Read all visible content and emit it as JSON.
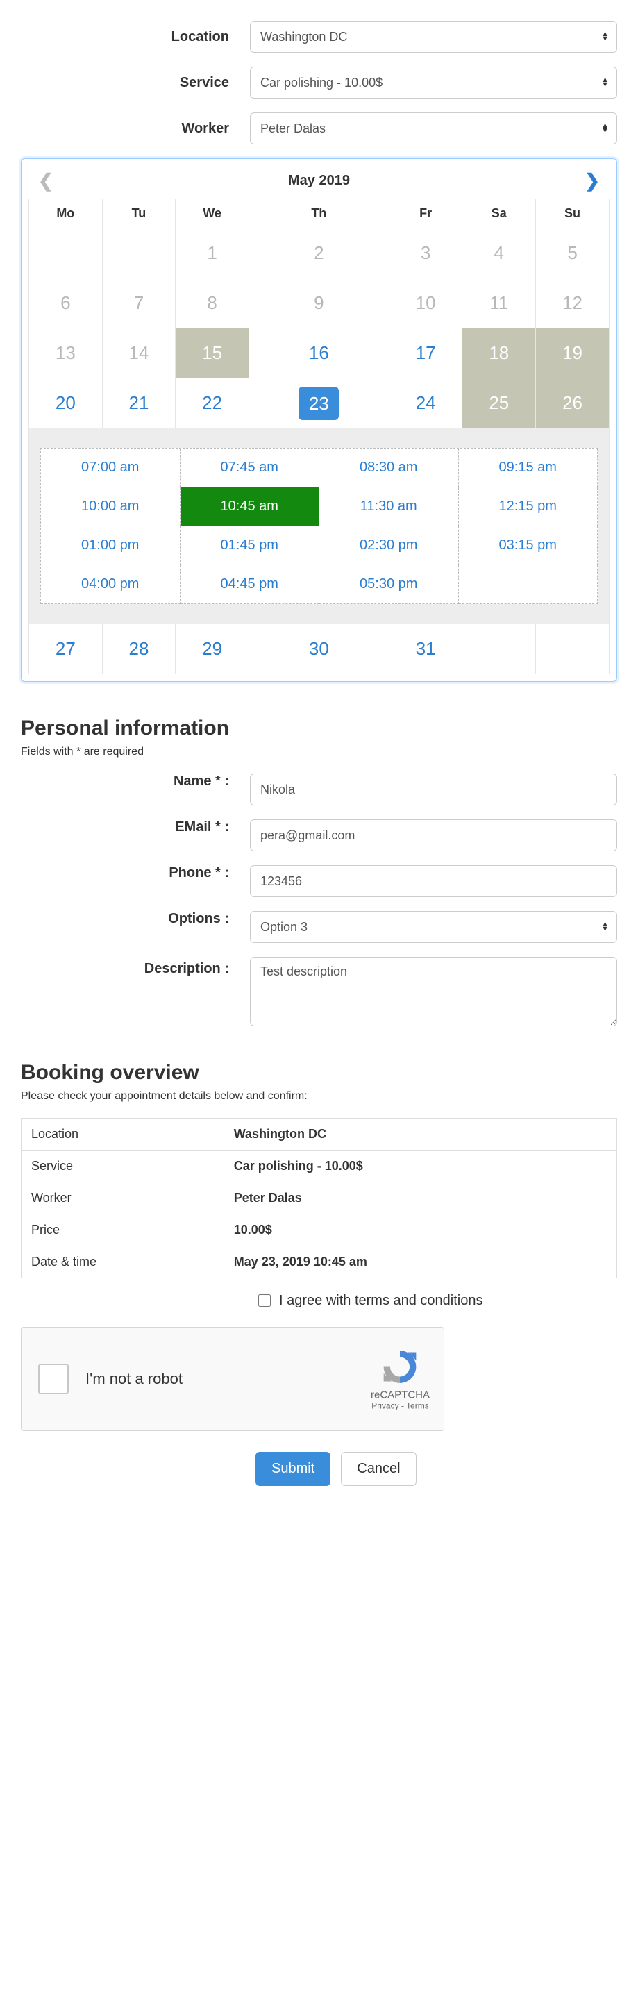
{
  "filters": {
    "location_label": "Location",
    "location_value": "Washington DC",
    "service_label": "Service",
    "service_value": "Car polishing - 10.00$",
    "worker_label": "Worker",
    "worker_value": "Peter Dalas"
  },
  "calendar": {
    "title": "May 2019",
    "dow": [
      "Mo",
      "Tu",
      "We",
      "Th",
      "Fr",
      "Sa",
      "Su"
    ],
    "weeks": [
      [
        {
          "n": "",
          "s": "empty"
        },
        {
          "n": "",
          "s": "empty"
        },
        {
          "n": "1",
          "s": "disabled"
        },
        {
          "n": "2",
          "s": "disabled"
        },
        {
          "n": "3",
          "s": "disabled"
        },
        {
          "n": "4",
          "s": "disabled"
        },
        {
          "n": "5",
          "s": "disabled"
        }
      ],
      [
        {
          "n": "6",
          "s": "disabled"
        },
        {
          "n": "7",
          "s": "disabled"
        },
        {
          "n": "8",
          "s": "disabled"
        },
        {
          "n": "9",
          "s": "disabled"
        },
        {
          "n": "10",
          "s": "disabled"
        },
        {
          "n": "11",
          "s": "disabled"
        },
        {
          "n": "12",
          "s": "disabled"
        }
      ],
      [
        {
          "n": "13",
          "s": "disabled"
        },
        {
          "n": "14",
          "s": "disabled"
        },
        {
          "n": "15",
          "s": "greyed"
        },
        {
          "n": "16",
          "s": "enabled"
        },
        {
          "n": "17",
          "s": "enabled"
        },
        {
          "n": "18",
          "s": "greyed"
        },
        {
          "n": "19",
          "s": "greyed"
        }
      ],
      [
        {
          "n": "20",
          "s": "enabled"
        },
        {
          "n": "21",
          "s": "enabled"
        },
        {
          "n": "22",
          "s": "enabled"
        },
        {
          "n": "23",
          "s": "selected"
        },
        {
          "n": "24",
          "s": "enabled"
        },
        {
          "n": "25",
          "s": "greyed"
        },
        {
          "n": "26",
          "s": "greyed"
        }
      ],
      [
        {
          "n": "27",
          "s": "enabled"
        },
        {
          "n": "28",
          "s": "enabled"
        },
        {
          "n": "29",
          "s": "enabled"
        },
        {
          "n": "30",
          "s": "enabled"
        },
        {
          "n": "31",
          "s": "enabled"
        },
        {
          "n": "",
          "s": "empty"
        },
        {
          "n": "",
          "s": "empty"
        }
      ]
    ],
    "slots": [
      {
        "t": "07:00 am",
        "sel": false
      },
      {
        "t": "07:45 am",
        "sel": false
      },
      {
        "t": "08:30 am",
        "sel": false
      },
      {
        "t": "09:15 am",
        "sel": false
      },
      {
        "t": "10:00 am",
        "sel": false
      },
      {
        "t": "10:45 am",
        "sel": true
      },
      {
        "t": "11:30 am",
        "sel": false
      },
      {
        "t": "12:15 pm",
        "sel": false
      },
      {
        "t": "01:00 pm",
        "sel": false
      },
      {
        "t": "01:45 pm",
        "sel": false
      },
      {
        "t": "02:30 pm",
        "sel": false
      },
      {
        "t": "03:15 pm",
        "sel": false
      },
      {
        "t": "04:00 pm",
        "sel": false
      },
      {
        "t": "04:45 pm",
        "sel": false
      },
      {
        "t": "05:30 pm",
        "sel": false
      }
    ],
    "slots_after_week_index": 3
  },
  "personal": {
    "heading": "Personal information",
    "sub": "Fields with * are required",
    "name_label": "Name * :",
    "name_value": "Nikola",
    "email_label": "EMail * :",
    "email_value": "pera@gmail.com",
    "phone_label": "Phone * :",
    "phone_value": "123456",
    "options_label": "Options :",
    "options_value": "Option 3",
    "description_label": "Description :",
    "description_value": "Test description"
  },
  "overview": {
    "heading": "Booking overview",
    "sub": "Please check your appointment details below and confirm:",
    "rows": [
      {
        "k": "Location",
        "v": "Washington DC"
      },
      {
        "k": "Service",
        "v": "Car polishing - 10.00$"
      },
      {
        "k": "Worker",
        "v": "Peter Dalas"
      },
      {
        "k": "Price",
        "v": "10.00$"
      },
      {
        "k": "Date & time",
        "v": "May 23, 2019 10:45 am"
      }
    ],
    "terms_label": "I agree with terms and conditions"
  },
  "recaptcha": {
    "text": "I'm not a robot",
    "brand": "reCAPTCHA",
    "legal": "Privacy - Terms"
  },
  "buttons": {
    "submit": "Submit",
    "cancel": "Cancel"
  }
}
